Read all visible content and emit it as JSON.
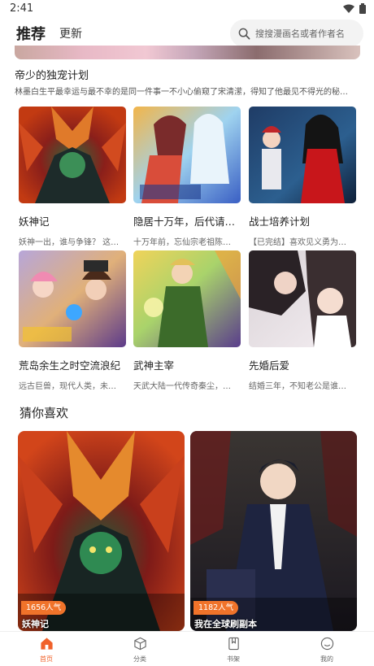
{
  "status_bar": {
    "time": "2:41"
  },
  "header": {
    "tabs": [
      {
        "label": "推荐"
      },
      {
        "label": "更新"
      }
    ],
    "search": {
      "placeholder": "搜搜漫画名或者作者名"
    }
  },
  "featured": {
    "title": "帝少的独宠计划",
    "description": "林墨白生平最幸运与最不幸的是同一件事一不小心偷窥了宋清潆，得知了他最见不得光的秘…"
  },
  "grid": [
    {
      "title": "妖神记",
      "desc": "妖神一出，谁与争锋？ 这…"
    },
    {
      "title": "隐居十万年，后代请…",
      "desc": "十万年前，忘仙宗老祖陈…"
    },
    {
      "title": "战士培养计划",
      "desc": "【已完结】喜欢见义勇为…"
    },
    {
      "title": "荒岛余生之时空流浪纪",
      "desc": "远古巨兽，现代人类，未…"
    },
    {
      "title": "武神主宰",
      "desc": "天武大陆一代传奇秦尘，…"
    },
    {
      "title": "先婚后爱",
      "desc": "结婚三年，不知老公是谁…"
    }
  ],
  "guess_section": {
    "title": "猜你喜欢",
    "items": [
      {
        "title": "妖神记",
        "popularity": "1656人气"
      },
      {
        "title": "我在全球刷副本",
        "popularity": "1182人气"
      }
    ]
  },
  "bottom_nav": [
    {
      "label": "首页",
      "icon": "home-icon"
    },
    {
      "label": "分类",
      "icon": "category-cube-icon"
    },
    {
      "label": "书架",
      "icon": "bookshelf-icon"
    },
    {
      "label": "我的",
      "icon": "profile-smile-icon"
    }
  ],
  "colors": {
    "accent": "#f0612a",
    "badge": "#f0732a",
    "search_bg": "#f3f3f3"
  }
}
